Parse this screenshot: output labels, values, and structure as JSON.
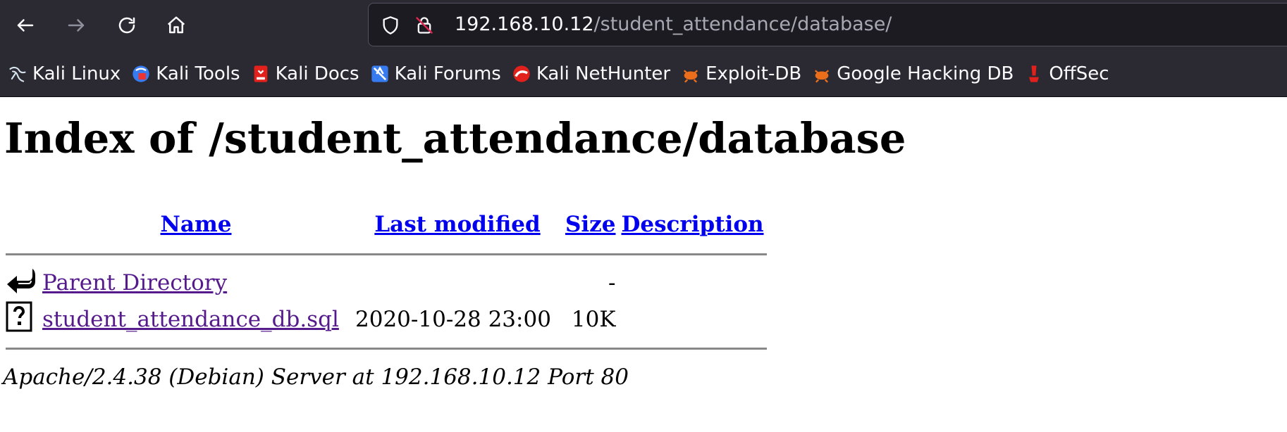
{
  "browser": {
    "url_host": "192.168.10.12",
    "url_path": "/student_attendance/database/",
    "bookmarks": [
      {
        "label": "Kali Linux",
        "icon": "kali-dragon-icon"
      },
      {
        "label": "Kali Tools",
        "icon": "kali-tools-icon"
      },
      {
        "label": "Kali Docs",
        "icon": "kali-docs-icon"
      },
      {
        "label": "Kali Forums",
        "icon": "kali-forums-icon"
      },
      {
        "label": "Kali NetHunter",
        "icon": "kali-nethunter-icon"
      },
      {
        "label": "Exploit-DB",
        "icon": "exploit-db-icon"
      },
      {
        "label": "Google Hacking DB",
        "icon": "ghdb-icon"
      },
      {
        "label": "OffSec",
        "icon": "offsec-icon"
      }
    ]
  },
  "page": {
    "title": "Index of /student_attendance/database",
    "columns": {
      "name": "Name",
      "last_modified": "Last modified",
      "size": "Size",
      "description": "Description"
    },
    "rows": [
      {
        "icon": "back-arrow-icon",
        "name": "Parent Directory",
        "last_modified": "",
        "size": "-",
        "description": ""
      },
      {
        "icon": "unknown-file-icon",
        "name": "student_attendance_db.sql",
        "last_modified": "2020-10-28 23:00",
        "size": "10K",
        "description": ""
      }
    ],
    "footer": "Apache/2.4.38 (Debian) Server at 192.168.10.12 Port 80"
  }
}
